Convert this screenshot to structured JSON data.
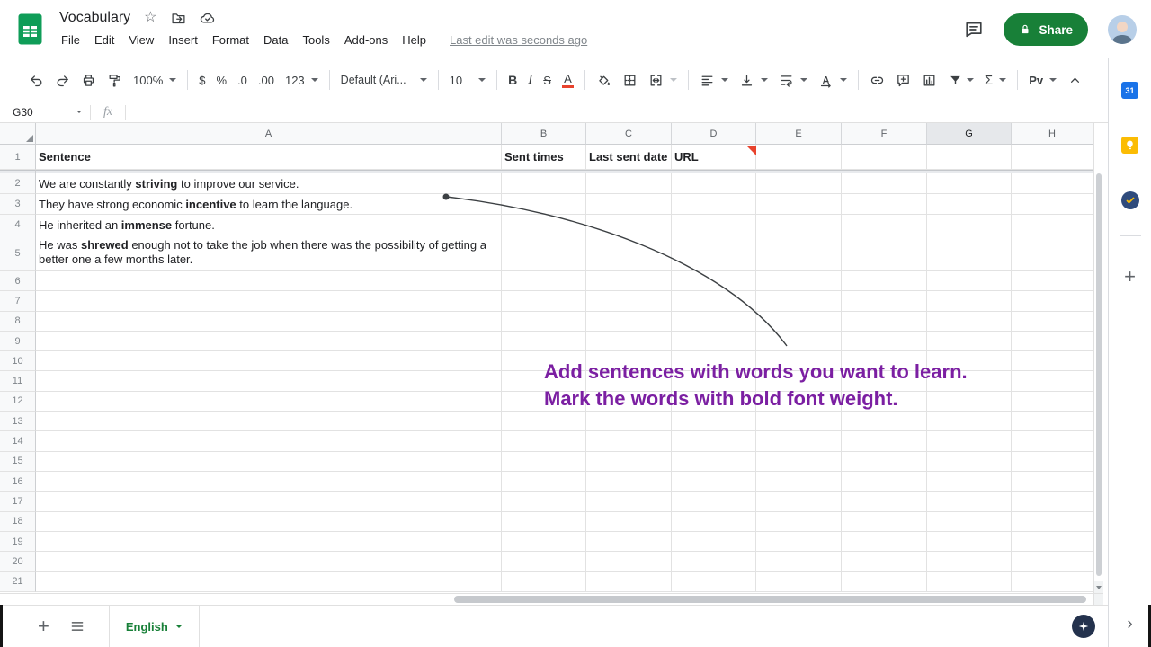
{
  "header": {
    "title": "Vocabulary",
    "menus": [
      "File",
      "Edit",
      "View",
      "Insert",
      "Format",
      "Data",
      "Tools",
      "Add-ons",
      "Help"
    ],
    "last_edit": "Last edit was seconds ago",
    "share_label": "Share"
  },
  "toolbar": {
    "zoom": "100%",
    "currency": "$",
    "percent": "%",
    "decrease_decimal": ".0",
    "increase_decimal": ".00",
    "number_format": "123",
    "font_name": "Default (Ari...",
    "font_size": "10",
    "bold": "B",
    "italic": "I",
    "strikethrough": "S",
    "text_color": "A",
    "functions": "Σ",
    "more": "Pv"
  },
  "formula_bar": {
    "cell_ref": "G30",
    "fx_label": "fx"
  },
  "sheet": {
    "columns": [
      "A",
      "B",
      "C",
      "D",
      "E",
      "F",
      "G",
      "H"
    ],
    "selected_column": "G",
    "row_count": 21,
    "frozen_header": [
      "Sentence",
      "Sent times",
      "Last sent date",
      "URL"
    ],
    "rows": [
      [
        {
          "t": "We are constantly "
        },
        {
          "t": "striving",
          "b": true
        },
        {
          "t": " to improve our service."
        }
      ],
      [
        {
          "t": "They have strong economic "
        },
        {
          "t": "incentive",
          "b": true
        },
        {
          "t": " to learn the language."
        }
      ],
      [
        {
          "t": "He inherited an "
        },
        {
          "t": "immense",
          "b": true
        },
        {
          "t": " fortune."
        }
      ],
      [
        {
          "t": "He was "
        },
        {
          "t": "shrewed",
          "b": true
        },
        {
          "t": " enough not to take the job when there was the possibility of getting a better one a few months later."
        }
      ]
    ]
  },
  "annotation": {
    "line1": "Add sentences with words you want to learn.",
    "line2": "Mark the words with bold font weight.",
    "color": "#7b1fa2"
  },
  "footer": {
    "sheet_tab": "English"
  },
  "side_panel": {
    "calendar_text": "31"
  },
  "colors": {
    "brand_green": "#0f9d58",
    "share_green": "#188038",
    "marker_red": "#e8432d",
    "connector": "#3c4043",
    "accent_purple": "#7b1fa2"
  }
}
